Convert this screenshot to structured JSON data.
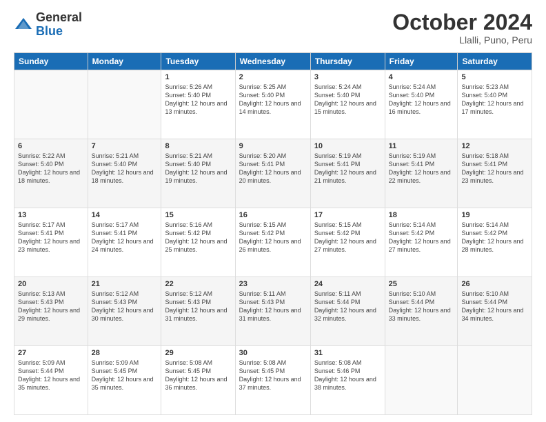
{
  "header": {
    "logo_general": "General",
    "logo_blue": "Blue",
    "month_title": "October 2024",
    "location": "Llalli, Puno, Peru"
  },
  "weekdays": [
    "Sunday",
    "Monday",
    "Tuesday",
    "Wednesday",
    "Thursday",
    "Friday",
    "Saturday"
  ],
  "weeks": [
    [
      {
        "day": "",
        "sunrise": "",
        "sunset": "",
        "daylight": ""
      },
      {
        "day": "",
        "sunrise": "",
        "sunset": "",
        "daylight": ""
      },
      {
        "day": "1",
        "sunrise": "Sunrise: 5:26 AM",
        "sunset": "Sunset: 5:40 PM",
        "daylight": "Daylight: 12 hours and 13 minutes."
      },
      {
        "day": "2",
        "sunrise": "Sunrise: 5:25 AM",
        "sunset": "Sunset: 5:40 PM",
        "daylight": "Daylight: 12 hours and 14 minutes."
      },
      {
        "day": "3",
        "sunrise": "Sunrise: 5:24 AM",
        "sunset": "Sunset: 5:40 PM",
        "daylight": "Daylight: 12 hours and 15 minutes."
      },
      {
        "day": "4",
        "sunrise": "Sunrise: 5:24 AM",
        "sunset": "Sunset: 5:40 PM",
        "daylight": "Daylight: 12 hours and 16 minutes."
      },
      {
        "day": "5",
        "sunrise": "Sunrise: 5:23 AM",
        "sunset": "Sunset: 5:40 PM",
        "daylight": "Daylight: 12 hours and 17 minutes."
      }
    ],
    [
      {
        "day": "6",
        "sunrise": "Sunrise: 5:22 AM",
        "sunset": "Sunset: 5:40 PM",
        "daylight": "Daylight: 12 hours and 18 minutes."
      },
      {
        "day": "7",
        "sunrise": "Sunrise: 5:21 AM",
        "sunset": "Sunset: 5:40 PM",
        "daylight": "Daylight: 12 hours and 18 minutes."
      },
      {
        "day": "8",
        "sunrise": "Sunrise: 5:21 AM",
        "sunset": "Sunset: 5:40 PM",
        "daylight": "Daylight: 12 hours and 19 minutes."
      },
      {
        "day": "9",
        "sunrise": "Sunrise: 5:20 AM",
        "sunset": "Sunset: 5:41 PM",
        "daylight": "Daylight: 12 hours and 20 minutes."
      },
      {
        "day": "10",
        "sunrise": "Sunrise: 5:19 AM",
        "sunset": "Sunset: 5:41 PM",
        "daylight": "Daylight: 12 hours and 21 minutes."
      },
      {
        "day": "11",
        "sunrise": "Sunrise: 5:19 AM",
        "sunset": "Sunset: 5:41 PM",
        "daylight": "Daylight: 12 hours and 22 minutes."
      },
      {
        "day": "12",
        "sunrise": "Sunrise: 5:18 AM",
        "sunset": "Sunset: 5:41 PM",
        "daylight": "Daylight: 12 hours and 23 minutes."
      }
    ],
    [
      {
        "day": "13",
        "sunrise": "Sunrise: 5:17 AM",
        "sunset": "Sunset: 5:41 PM",
        "daylight": "Daylight: 12 hours and 23 minutes."
      },
      {
        "day": "14",
        "sunrise": "Sunrise: 5:17 AM",
        "sunset": "Sunset: 5:41 PM",
        "daylight": "Daylight: 12 hours and 24 minutes."
      },
      {
        "day": "15",
        "sunrise": "Sunrise: 5:16 AM",
        "sunset": "Sunset: 5:42 PM",
        "daylight": "Daylight: 12 hours and 25 minutes."
      },
      {
        "day": "16",
        "sunrise": "Sunrise: 5:15 AM",
        "sunset": "Sunset: 5:42 PM",
        "daylight": "Daylight: 12 hours and 26 minutes."
      },
      {
        "day": "17",
        "sunrise": "Sunrise: 5:15 AM",
        "sunset": "Sunset: 5:42 PM",
        "daylight": "Daylight: 12 hours and 27 minutes."
      },
      {
        "day": "18",
        "sunrise": "Sunrise: 5:14 AM",
        "sunset": "Sunset: 5:42 PM",
        "daylight": "Daylight: 12 hours and 27 minutes."
      },
      {
        "day": "19",
        "sunrise": "Sunrise: 5:14 AM",
        "sunset": "Sunset: 5:42 PM",
        "daylight": "Daylight: 12 hours and 28 minutes."
      }
    ],
    [
      {
        "day": "20",
        "sunrise": "Sunrise: 5:13 AM",
        "sunset": "Sunset: 5:43 PM",
        "daylight": "Daylight: 12 hours and 29 minutes."
      },
      {
        "day": "21",
        "sunrise": "Sunrise: 5:12 AM",
        "sunset": "Sunset: 5:43 PM",
        "daylight": "Daylight: 12 hours and 30 minutes."
      },
      {
        "day": "22",
        "sunrise": "Sunrise: 5:12 AM",
        "sunset": "Sunset: 5:43 PM",
        "daylight": "Daylight: 12 hours and 31 minutes."
      },
      {
        "day": "23",
        "sunrise": "Sunrise: 5:11 AM",
        "sunset": "Sunset: 5:43 PM",
        "daylight": "Daylight: 12 hours and 31 minutes."
      },
      {
        "day": "24",
        "sunrise": "Sunrise: 5:11 AM",
        "sunset": "Sunset: 5:44 PM",
        "daylight": "Daylight: 12 hours and 32 minutes."
      },
      {
        "day": "25",
        "sunrise": "Sunrise: 5:10 AM",
        "sunset": "Sunset: 5:44 PM",
        "daylight": "Daylight: 12 hours and 33 minutes."
      },
      {
        "day": "26",
        "sunrise": "Sunrise: 5:10 AM",
        "sunset": "Sunset: 5:44 PM",
        "daylight": "Daylight: 12 hours and 34 minutes."
      }
    ],
    [
      {
        "day": "27",
        "sunrise": "Sunrise: 5:09 AM",
        "sunset": "Sunset: 5:44 PM",
        "daylight": "Daylight: 12 hours and 35 minutes."
      },
      {
        "day": "28",
        "sunrise": "Sunrise: 5:09 AM",
        "sunset": "Sunset: 5:45 PM",
        "daylight": "Daylight: 12 hours and 35 minutes."
      },
      {
        "day": "29",
        "sunrise": "Sunrise: 5:08 AM",
        "sunset": "Sunset: 5:45 PM",
        "daylight": "Daylight: 12 hours and 36 minutes."
      },
      {
        "day": "30",
        "sunrise": "Sunrise: 5:08 AM",
        "sunset": "Sunset: 5:45 PM",
        "daylight": "Daylight: 12 hours and 37 minutes."
      },
      {
        "day": "31",
        "sunrise": "Sunrise: 5:08 AM",
        "sunset": "Sunset: 5:46 PM",
        "daylight": "Daylight: 12 hours and 38 minutes."
      },
      {
        "day": "",
        "sunrise": "",
        "sunset": "",
        "daylight": ""
      },
      {
        "day": "",
        "sunrise": "",
        "sunset": "",
        "daylight": ""
      }
    ]
  ]
}
